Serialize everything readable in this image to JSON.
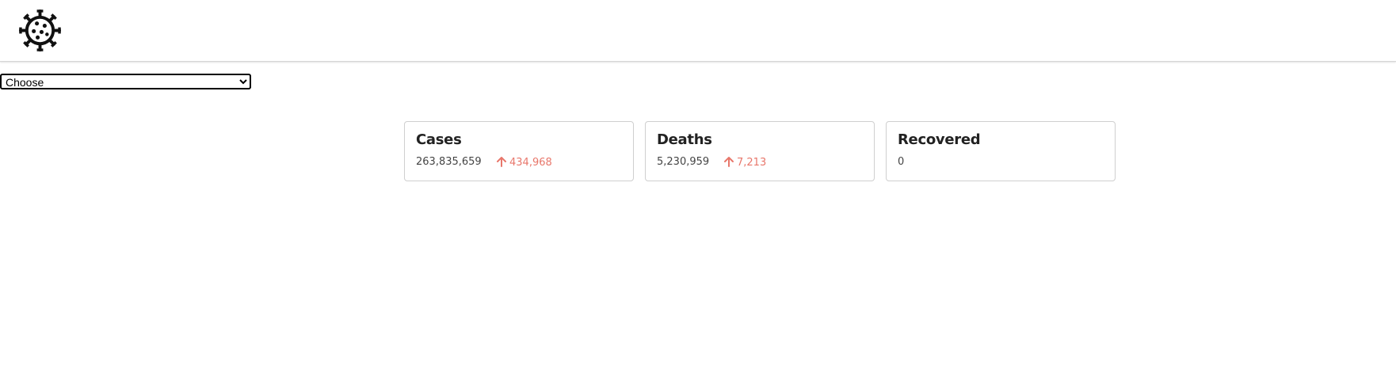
{
  "header": {
    "logo_icon": "virus-icon"
  },
  "country_select": {
    "selected": "Choose"
  },
  "cards": [
    {
      "title": "Cases",
      "total": "263,835,659",
      "delta": "434,968",
      "delta_icon": "arrow-up-icon"
    },
    {
      "title": "Deaths",
      "total": "5,230,959",
      "delta": "7,213",
      "delta_icon": "arrow-up-icon"
    },
    {
      "title": "Recovered",
      "total": "0"
    }
  ],
  "colors": {
    "delta": "#e8776b",
    "border": "#cfcfcf"
  }
}
